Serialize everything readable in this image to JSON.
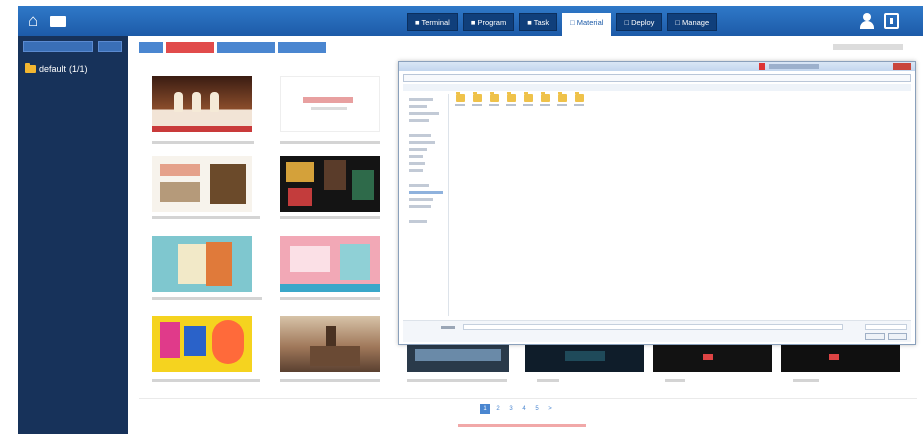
{
  "header": {
    "home_icon": "home-icon",
    "tabs": [
      {
        "label": "Terminal",
        "icon": "terminal-icon",
        "active": false
      },
      {
        "label": "Program",
        "icon": "program-icon",
        "active": false
      },
      {
        "label": "Task",
        "icon": "task-icon",
        "active": false
      },
      {
        "label": "Material",
        "icon": "material-icon",
        "active": true
      },
      {
        "label": "Deploy",
        "icon": "deploy-icon",
        "active": false
      },
      {
        "label": "Manage",
        "icon": "manage-icon",
        "active": false
      }
    ]
  },
  "sidebar": {
    "folder": {
      "name": "default",
      "count": "(1/1)"
    }
  },
  "pagination": {
    "pages": [
      "1",
      "2",
      "3",
      "4",
      "5",
      ">"
    ],
    "active_page": "1"
  },
  "colors": {
    "header": "#2f79c8",
    "sidebar": "#17325a",
    "tab_dark": "#103f7b",
    "accent": "#4a86d0",
    "danger": "#e14b4b"
  }
}
